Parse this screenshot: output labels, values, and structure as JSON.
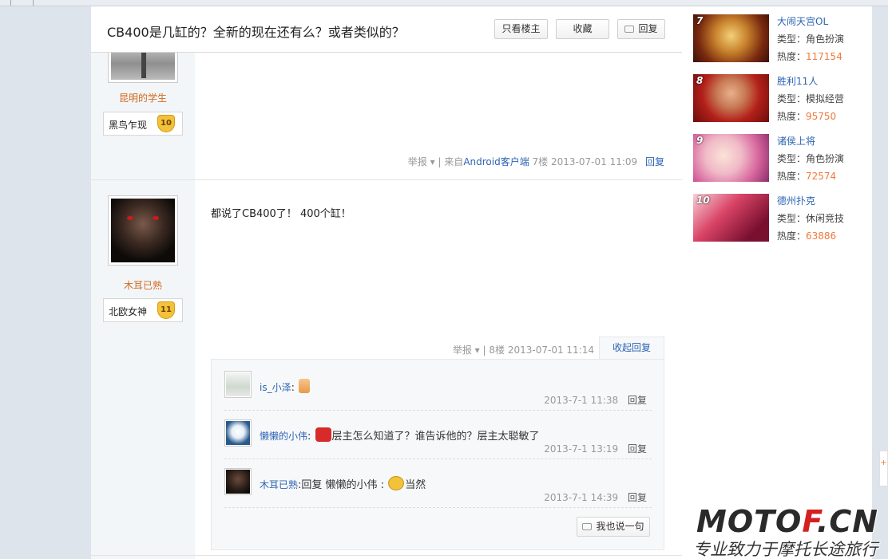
{
  "thread": {
    "title": "CB400是几缸的？全新的现在还有么？或者类似的？",
    "buttons": {
      "author_only": "只看楼主",
      "favorite": "收藏",
      "reply": "回复"
    }
  },
  "posts": [
    {
      "username": "昆明的学生",
      "level_name": "黑鸟乍现",
      "level_num": "10",
      "report": "举报",
      "source_prefix": "来自",
      "source_link": "Android客户端",
      "floor": "7楼",
      "time": "2013-07-01 11:09",
      "reply": "回复"
    },
    {
      "username": "木耳已熟",
      "level_name": "北欧女神",
      "level_num": "11",
      "content": "都说了CB400了！ 400个缸！",
      "report": "举报",
      "floor": "8楼",
      "time": "2013-07-01 11:14",
      "collapse_reply": "收起回复",
      "sub_replies": [
        {
          "name": "is_小泽",
          "text": "",
          "time": "2013-7-1 11:38",
          "reply": "回复",
          "emoji": "thumbs-up"
        },
        {
          "name": "懒懒的小伟",
          "text": "层主怎么知道了？谁告诉他的？层主太聪敏了",
          "time": "2013-7-1 13:19",
          "reply": "回复",
          "emoji": "red-face"
        },
        {
          "name": "木耳已熟",
          "text": "回复 懒懒的小伟 :",
          "text_after": "当然",
          "time": "2013-7-1 14:39",
          "reply": "回复",
          "emoji": "cool-face"
        }
      ],
      "say_button": "我也说一句"
    }
  ],
  "sidebar": {
    "type_label": "类型：",
    "heat_label": "热度：",
    "games": [
      {
        "rank": "7",
        "name": "大闹天宫OL",
        "type": "角色扮演",
        "heat": "117154"
      },
      {
        "rank": "8",
        "name": "胜利11人",
        "type": "模拟经营",
        "heat": "95750"
      },
      {
        "rank": "9",
        "name": "诸侯上将",
        "type": "角色扮演",
        "heat": "72574"
      },
      {
        "rank": "10",
        "name": "德州扑克",
        "type": "休闲竞技",
        "heat": "63886"
      }
    ]
  },
  "watermark": {
    "brand_a": "MOTO",
    "brand_b": "F",
    "brand_c": ".CN",
    "slogan": "专业致力于摩托长途旅行"
  },
  "colors": {
    "link": "#2d64b3",
    "username": "#d2691e",
    "heat": "#f07a3a"
  }
}
